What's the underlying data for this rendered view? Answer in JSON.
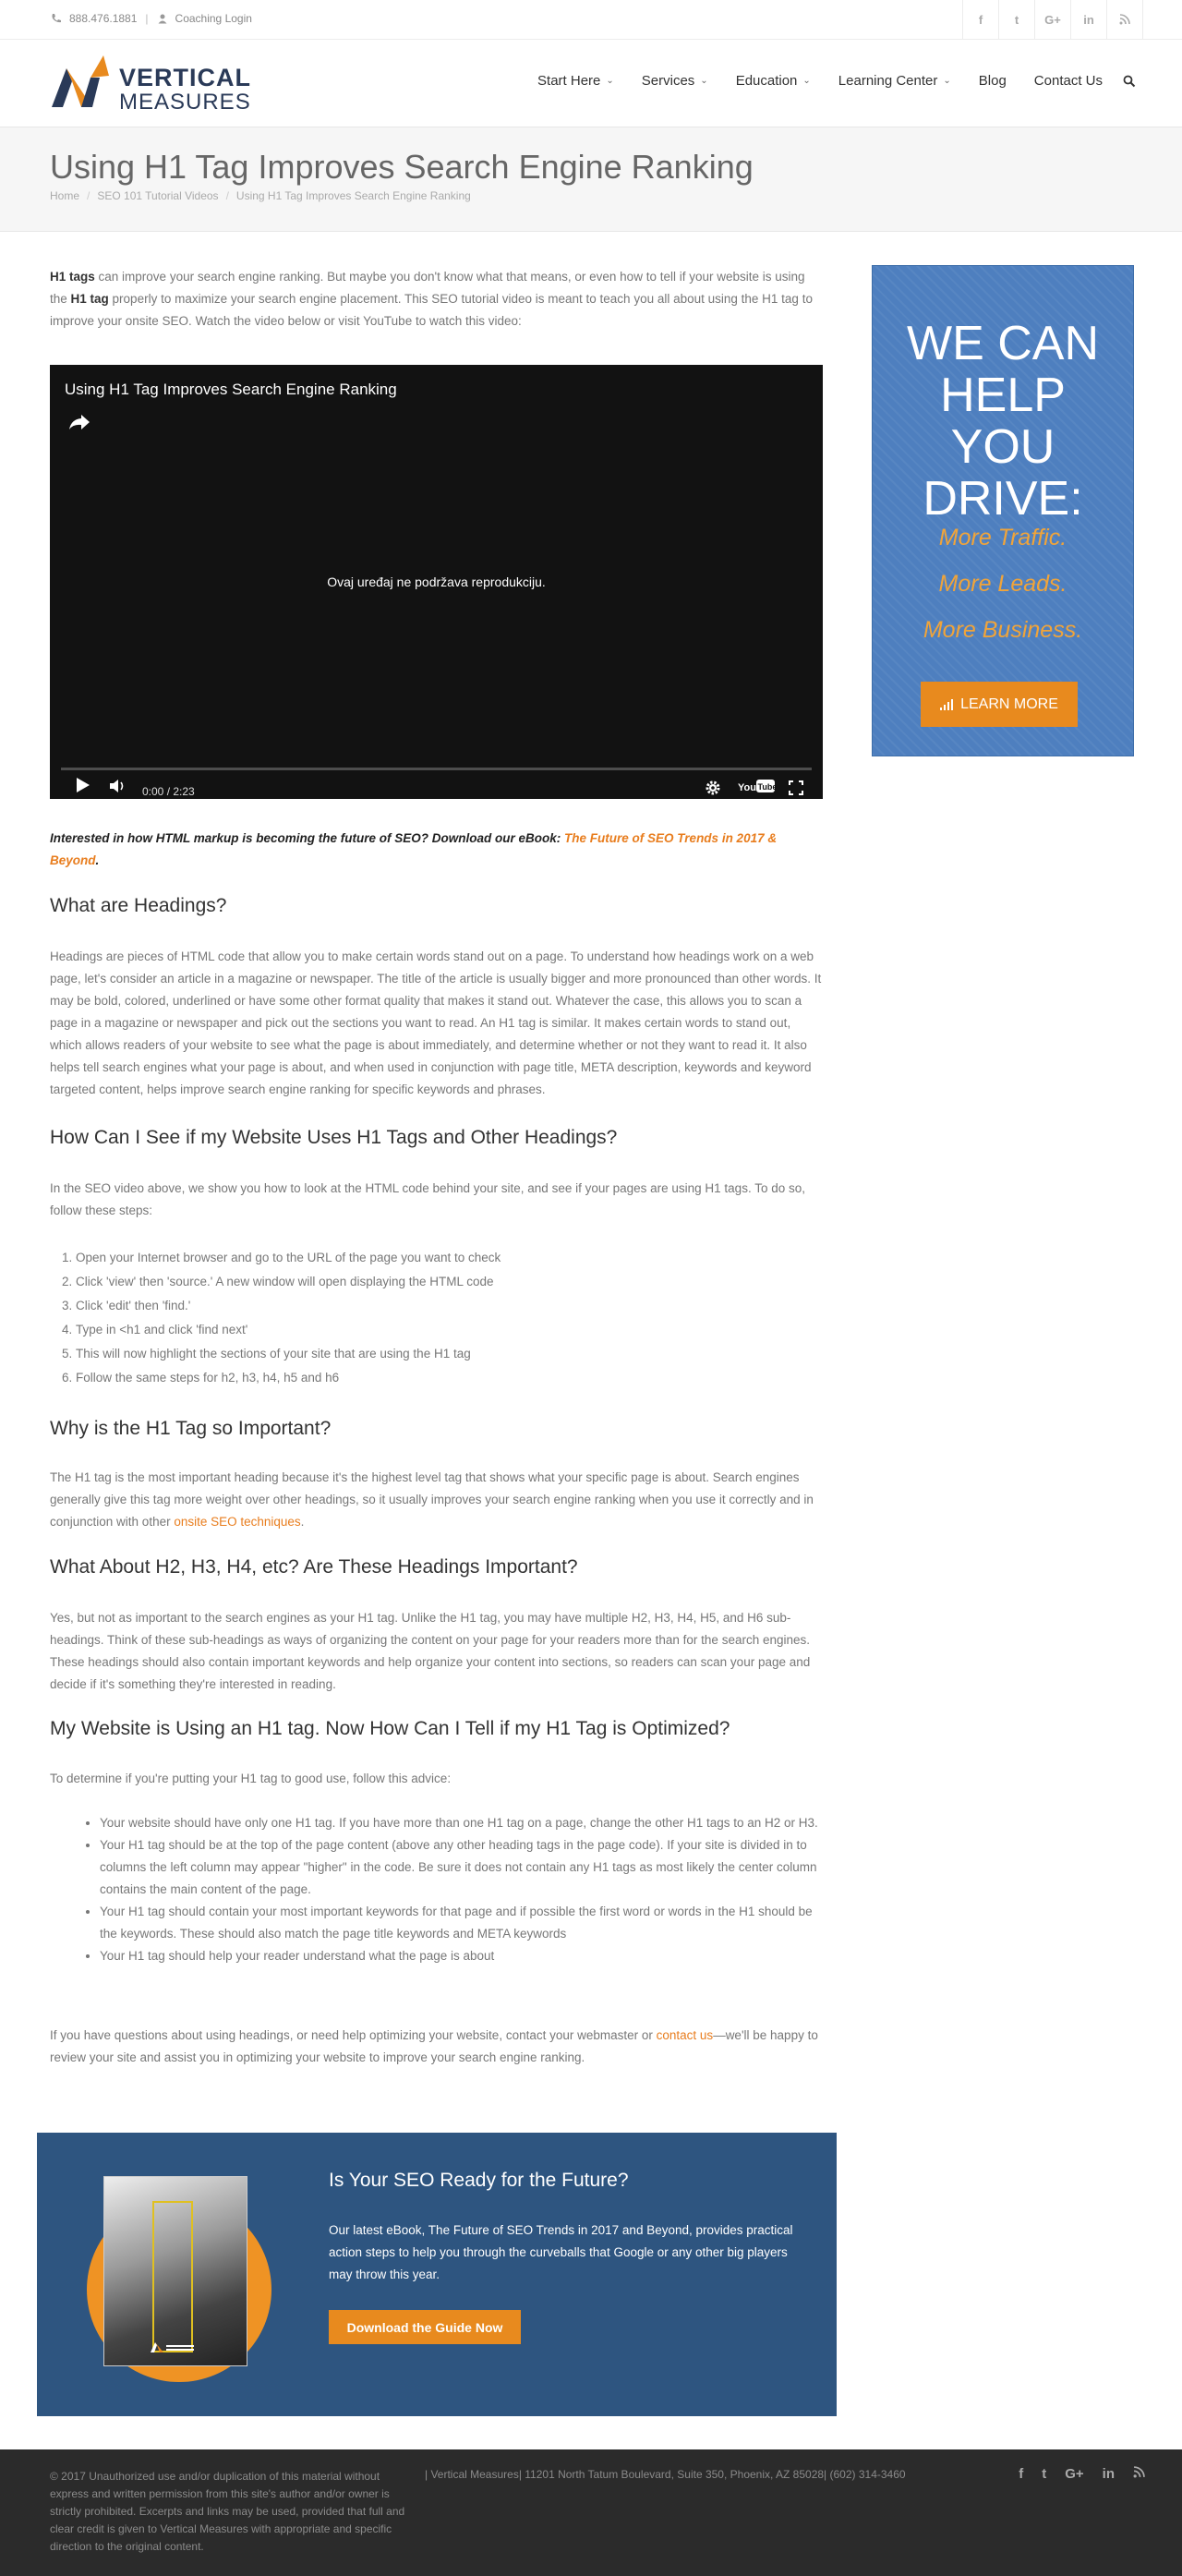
{
  "topbar": {
    "phone": "888.476.1881",
    "separator": "|",
    "coaching_login": "Coaching Login",
    "social": [
      "f",
      "t",
      "G+",
      "in",
      "rss"
    ]
  },
  "header": {
    "logo_line1": "VERTICAL",
    "logo_line2": "MEASURES",
    "nav": [
      {
        "label": "Start Here",
        "dropdown": true
      },
      {
        "label": "Services",
        "dropdown": true
      },
      {
        "label": "Education",
        "dropdown": true
      },
      {
        "label": "Learning Center",
        "dropdown": true
      },
      {
        "label": "Blog",
        "dropdown": false
      },
      {
        "label": "Contact Us",
        "dropdown": false
      }
    ]
  },
  "page": {
    "title": "Using H1 Tag Improves Search Engine Ranking",
    "breadcrumb": [
      "Home",
      "SEO 101 Tutorial Videos",
      "Using H1 Tag Improves Search Engine Ranking"
    ]
  },
  "content": {
    "intro_b1": "H1 tags",
    "intro_t1": " can improve your search engine ranking. But maybe you don't know what that means, or even how to tell if your website is using the ",
    "intro_b2": "H1 tag",
    "intro_t2": " properly to maximize your search engine placement. This SEO tutorial video is meant to teach you all about using the H1 tag to improve your onsite SEO. Watch the video below or visit YouTube to watch this video:",
    "video": {
      "title": "Using H1 Tag Improves Search Engine Ranking",
      "message": "Ovaj uređaj ne podržava reprodukciju.",
      "time": "0:00 / 2:23"
    },
    "cta_text": "Interested in how HTML markup is becoming the future of SEO? Download our eBook: ",
    "cta_link": "The Future of SEO Trends in 2017 & Beyond",
    "cta_end": ".",
    "h_headings": "What are Headings?",
    "p_headings": "Headings are pieces of HTML code that allow you to make certain words stand out on a page. To understand how headings work on a web page, let's consider an article in a magazine or newspaper. The title of the article is usually bigger and more pronounced than other words. It may be bold, colored, underlined or have some other format quality that makes it stand out. Whatever the case, this allows you to scan a page in a magazine or newspaper and pick out the sections you want to read. An H1 tag is similar. It makes certain words to stand out, which allows readers of your website to see what the page is about immediately, and determine whether or not they want to read it. It also helps tell search engines what your page is about, and when used in conjunction with page title, META description, keywords and keyword targeted content, helps improve search engine ranking for specific keywords and phrases.",
    "h_how": "How Can I See if my Website Uses H1 Tags and Other Headings?",
    "p_how": "In the SEO video above, we show you how to look at the HTML code behind your site, and see if your pages are using H1 tags.  To do so, follow these steps:",
    "steps": [
      "Open your Internet browser and go to the URL of the page you want to check",
      "Click 'view' then 'source.' A new window will open displaying the HTML code",
      "Click 'edit' then 'find.'",
      "Type in <h1 and click 'find next'",
      "This will now highlight the sections of your site that are using the H1 tag",
      "Follow the same steps for h2, h3, h4, h5 and h6"
    ],
    "h_why": "Why is the H1 Tag so Important?",
    "p_why": "The H1 tag is the most important heading because it's the highest level tag that shows what your specific page is about. Search engines generally give this tag more weight over other headings, so it usually improves your search engine ranking when you use it correctly and in conjunction with other ",
    "p_why_link": "onsite SEO techniques",
    "p_why_end": ".",
    "h_h2": "What About H2, H3, H4, etc? Are These Headings Important?",
    "p_h2": "Yes, but not as important to the search engines as your H1 tag. Unlike the H1 tag, you may have multiple H2, H3, H4, H5, and H6 sub-headings. Think of these sub-headings as ways of organizing the content on your page for your readers more than for the search engines. These headings should also contain important keywords and help organize your content into sections, so readers can scan your page and decide if it's something they're interested in reading.",
    "h_opt": "My Website is Using an H1 tag. Now How Can I Tell if my H1 Tag is Optimized?",
    "p_opt": "To determine if you're putting your H1 tag to good use, follow this advice:",
    "tips": [
      "Your website should have only one H1 tag. If you have more than one H1 tag on a page, change the other H1 tags to an H2 or H3.",
      "Your H1 tag should be at the top of the page content (above any other heading tags in the page code). If your site is divided in to columns the left column may appear \"higher\" in the code. Be sure it does not contain any H1 tags as most likely the center column contains the main content of the page.",
      "Your H1 tag should contain your most important keywords for that page and if possible the first word or words in the H1 should be the keywords. These should also match the page title keywords and META keywords",
      "Your H1 tag should help your reader understand what the page is about"
    ],
    "p_end1": "If you have questions about using headings, or need help optimizing your website, contact your webmaster or ",
    "p_end_link": "contact us",
    "p_end2": "—we'll be happy to review your site and assist you in optimizing your website to improve your search engine ranking."
  },
  "sidebar_ad": {
    "line1": "WE CAN",
    "line2": "HELP",
    "line3": "YOU",
    "line4": "DRIVE:",
    "o1": "More Traffic.",
    "o2": "More Leads.",
    "o3": "More Business.",
    "button": "LEARN MORE",
    "bg": "#4e7fbf",
    "accent": "#e88a1e"
  },
  "promo": {
    "title": "Is Your SEO Ready for the Future?",
    "text": "Our latest eBook, The Future of SEO Trends in 2017 and Beyond, provides practical action steps to help you through the curveballs that Google or any other big players may throw this year.",
    "button": "Download the Guide Now",
    "bg": "#2e5580"
  },
  "footer": {
    "copyright": "© 2017 Unauthorized use and/or duplication of this material without express and written permission from this site's author and/or owner is strictly prohibited. Excerpts and links may be used, provided that full and clear credit is given to Vertical Measures with appropriate and specific direction to the original content.",
    "address": "| Vertical Measures| 11201 North Tatum Boulevard, Suite 350, Phoenix, AZ 85028| (602) 314-3460",
    "social": [
      "f",
      "t",
      "G+",
      "in",
      "rss"
    ]
  },
  "colors": {
    "accent_orange": "#e87d1e",
    "dark_navy": "#2a3a58"
  }
}
